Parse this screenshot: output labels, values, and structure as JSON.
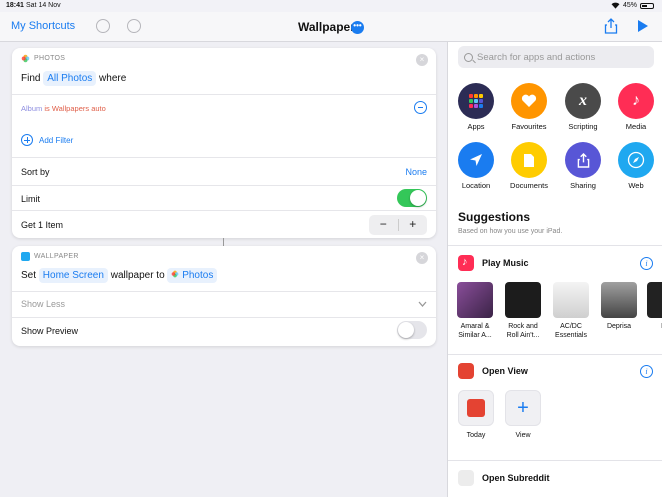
{
  "status_bar": {
    "time": "18:41",
    "date": "Sat 14 Nov",
    "battery": "45%"
  },
  "toolbar": {
    "back_label": "My Shortcuts",
    "title": "Wallpaper",
    "more_glyph": "•••"
  },
  "editor": {
    "photos_action": {
      "header": "PHOTOS",
      "find_word": "Find",
      "find_value": "All Photos",
      "where_word": "where",
      "filter": {
        "field": "Album",
        "op": "is",
        "value": "Wallpapers auto"
      },
      "add_filter": "Add Filter",
      "sort_label": "Sort by",
      "sort_value": "None",
      "limit_label": "Limit",
      "limit_on": true,
      "get_label": "Get 1 Item",
      "minus": "−",
      "plus": "+"
    },
    "wallpaper_action": {
      "header": "WALLPAPER",
      "set_word": "Set",
      "screen_value": "Home Screen",
      "wallpaper_to": "wallpaper to",
      "photos_value": "Photos",
      "show_less": "Show Less",
      "preview_label": "Show Preview",
      "preview_on": false
    }
  },
  "sidebar": {
    "search_placeholder": "Search for apps and actions",
    "categories": [
      {
        "label": "Apps",
        "icon": "apps-grid-icon",
        "color": "#2c2c55"
      },
      {
        "label": "Favourites",
        "icon": "heart-icon",
        "color": "#ff9500"
      },
      {
        "label": "Scripting",
        "icon": "script-x-icon",
        "color": "#4a4a4a"
      },
      {
        "label": "Media",
        "icon": "music-note-icon",
        "color": "#ff2d55"
      },
      {
        "label": "Location",
        "icon": "location-arrow-icon",
        "color": "#1a7cf0"
      },
      {
        "label": "Documents",
        "icon": "document-icon",
        "color": "#ffcc00"
      },
      {
        "label": "Sharing",
        "icon": "share-icon",
        "color": "#5856d6"
      },
      {
        "label": "Web",
        "icon": "compass-icon",
        "color": "#1fa8f0"
      }
    ],
    "suggestions_title": "Suggestions",
    "suggestions_subtitle": "Based on how you use your iPad.",
    "play_music": {
      "title": "Play Music",
      "albums": [
        {
          "label": "Amaral &\nSimilar A...",
          "color": "#5a3a66"
        },
        {
          "label": "Rock and\nRoll Ain't...",
          "color": "#1c1c1c"
        },
        {
          "label": "AC/DC\nEssentials",
          "color": "#e9e9e9"
        },
        {
          "label": "Deprisa",
          "color": "#7a7a7a"
        },
        {
          "label": "Lo",
          "color": "#222222"
        }
      ]
    },
    "open_view": {
      "title": "Open View",
      "tiles": [
        {
          "label": "Today"
        },
        {
          "label": "View"
        }
      ]
    },
    "open_subreddit": {
      "title": "Open Subreddit"
    }
  }
}
